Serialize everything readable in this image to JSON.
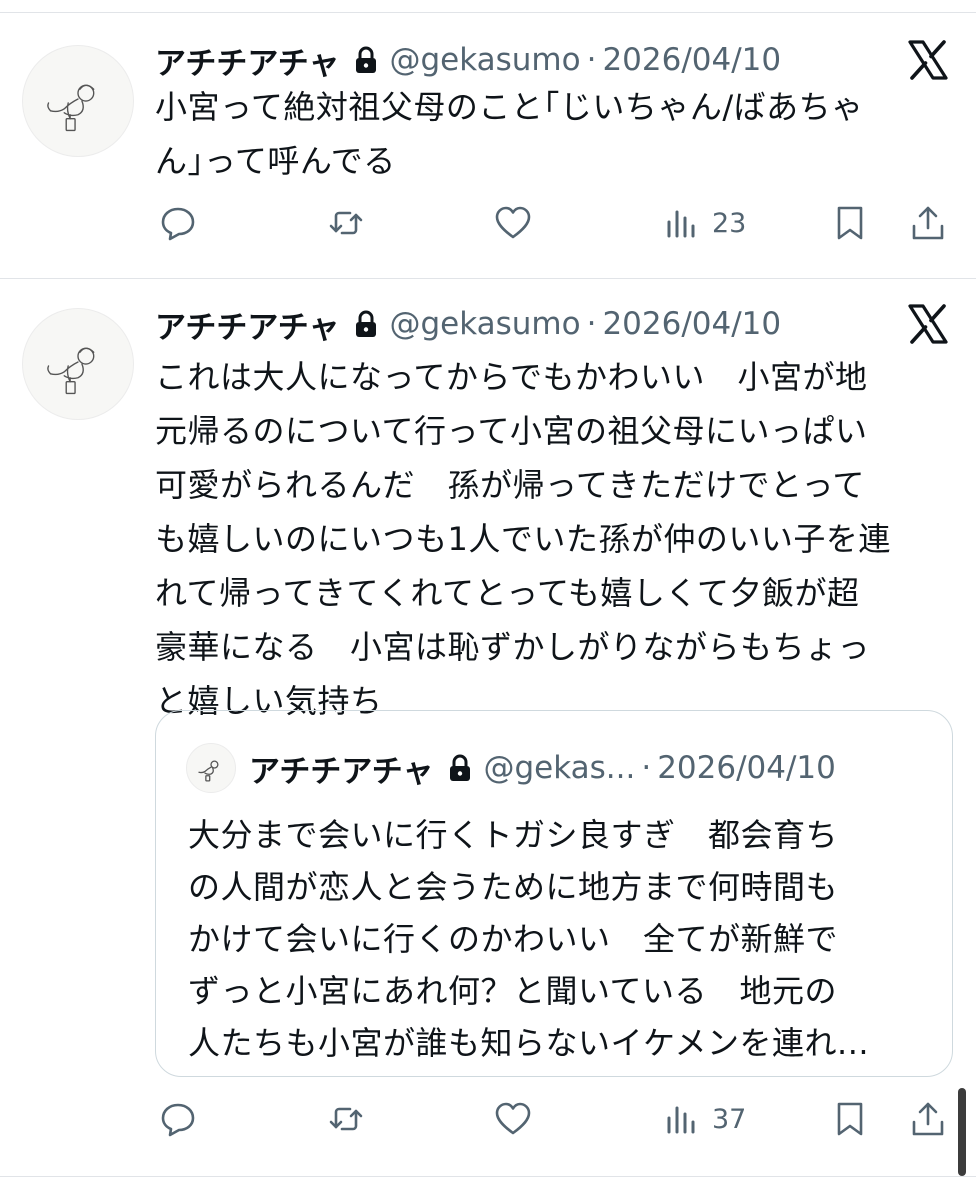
{
  "tweets": [
    {
      "author_name": "アチチアチャ",
      "handle": "@gekasumo",
      "separator": "·",
      "date": "2026/04/10",
      "text_lines": [
        "小宮って絶対祖父母のこと｢じいちゃん/ばあちゃ",
        "ん｣って呼んでる"
      ],
      "views": "23",
      "icons": [
        "reply-icon",
        "retweet-icon",
        "like-icon",
        "views-icon",
        "bookmark-icon",
        "share-icon",
        "lock-icon",
        "x-logo-icon"
      ]
    },
    {
      "author_name": "アチチアチャ",
      "handle": "@gekasumo",
      "separator": "·",
      "date": "2026/04/10",
      "text_lines": [
        "これは大人になってからでもかわいい　小宮が地",
        "元帰るのについて行って小宮の祖父母にいっぱい",
        "可愛がられるんだ　孫が帰ってきただけでとって",
        "も嬉しいのにいつも1人でいた孫が仲のいい子を連",
        "れて帰ってきてくれてとっても嬉しくて夕飯が超",
        "豪華になる　小宮は恥ずかしがりながらもちょっ",
        "と嬉しい気持ち"
      ],
      "views": "37",
      "quote": {
        "author_name": "アチチアチャ",
        "handle": "@gekas...",
        "separator": "·",
        "date": "2026/04/10",
        "text_lines": [
          "大分まで会いに行くトガシ良すぎ　都会育ち",
          "の人間が恋人と会うために地方まで何時間も",
          "かけて会いに行くのかわいい　全てが新鮮で",
          "ずっと小宮にあれ何？と聞いている　地元の",
          "人たちも小宮が誰も知らないイケメンを連れ..."
        ]
      }
    }
  ],
  "colors": {
    "text": "#0f1419",
    "secondary": "#536471",
    "border": "#cfd9de",
    "divider": "#e1e4e8"
  }
}
